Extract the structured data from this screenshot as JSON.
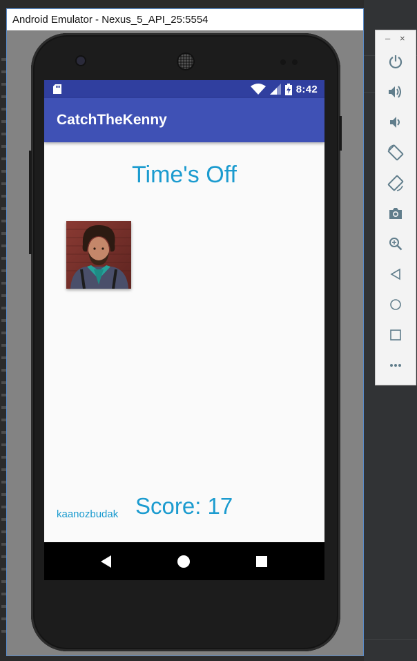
{
  "window": {
    "title": "Android Emulator - Nexus_5_API_25:5554"
  },
  "status_bar": {
    "time": "8:42"
  },
  "app": {
    "title": "CatchTheKenny",
    "time_text": "Time's Off",
    "user_name": "kaanozbudak",
    "score_text": "Score: 17"
  },
  "nav": {
    "back_icon": "back-triangle-icon",
    "home_icon": "home-circle-icon",
    "recents_icon": "recents-square-icon"
  },
  "toolbar": {
    "minimize": "–",
    "close": "×",
    "items": [
      "power-icon",
      "volume-up-icon",
      "volume-down-icon",
      "rotate-left-icon",
      "rotate-right-icon",
      "camera-icon",
      "zoom-icon",
      "back-icon",
      "home-icon",
      "overview-icon",
      "more-icon"
    ]
  },
  "colors": {
    "status_bar": "#303f9f",
    "app_bar": "#3f51b5",
    "accent_text": "#1b9bcf",
    "screen_bg": "#fafafa"
  }
}
